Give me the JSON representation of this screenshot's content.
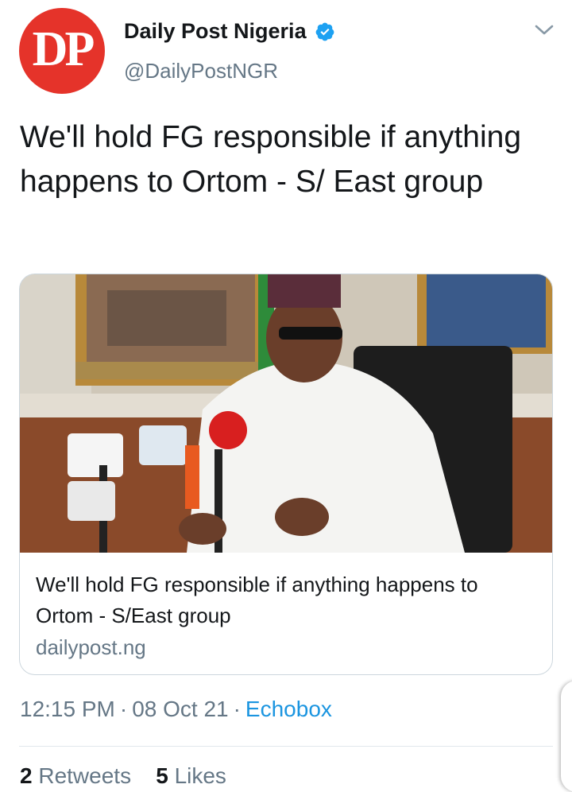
{
  "account": {
    "avatar_text": "DP",
    "name": "Daily Post Nigeria",
    "handle": "@DailyPostNGR",
    "verified": true
  },
  "tweet": {
    "text": "We'll hold FG responsible if anything happens to Ortom - S/ East group",
    "time": "12:15 PM",
    "date": "08 Oct 21",
    "source": "Echobox"
  },
  "card": {
    "title": "We'll hold FG responsible if anything happens to Ortom - S/East group",
    "domain": "dailypost.ng"
  },
  "stats": {
    "retweets_count": "2",
    "retweets_label": "Retweets",
    "likes_count": "5",
    "likes_label": "Likes"
  },
  "icons": {
    "verified": "verified-badge-icon",
    "menu": "chevron-down-icon"
  },
  "colors": {
    "brand_red": "#e5332a",
    "link_blue": "#1b95e0",
    "secondary_text": "#657786"
  }
}
